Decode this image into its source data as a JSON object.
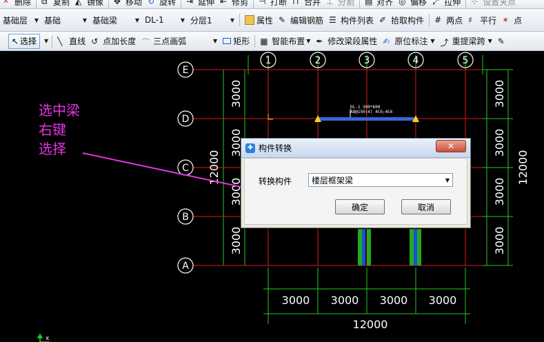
{
  "toolbar_top": {
    "items": [
      {
        "label": "删除",
        "icon": "delete-icon"
      },
      {
        "label": "复制",
        "icon": "copy-icon"
      },
      {
        "label": "镜像",
        "icon": "mirror-icon"
      },
      {
        "label": "移动",
        "icon": "move-icon"
      },
      {
        "label": "旋转",
        "icon": "rotate-icon"
      },
      {
        "label": "延伸",
        "icon": "extend-icon"
      },
      {
        "label": "修剪",
        "icon": "trim-icon"
      },
      {
        "label": "打断",
        "icon": "break-icon"
      },
      {
        "label": "合并",
        "icon": "merge-icon"
      },
      {
        "label": "分割",
        "icon": "split-icon"
      },
      {
        "label": "对齐",
        "icon": "align-icon"
      },
      {
        "label": "偏移",
        "icon": "offset-icon"
      },
      {
        "label": "拉伸",
        "icon": "stretch-icon"
      },
      {
        "label": "设置夹点",
        "icon": "grip-icon"
      }
    ]
  },
  "toolbar_mid": {
    "combos": [
      "基础层",
      "基础",
      "基础梁",
      "DL-1",
      "分层1"
    ],
    "buttons": [
      {
        "label": "属性",
        "icon": "properties-icon"
      },
      {
        "label": "编辑钢筋",
        "icon": "edit-rebar-icon"
      },
      {
        "label": "构件列表",
        "icon": "component-list-icon"
      },
      {
        "label": "拾取构件",
        "icon": "pick-component-icon"
      },
      {
        "label": "两点",
        "icon": "two-point-axis-icon"
      },
      {
        "label": "平行",
        "icon": "parallel-axis-icon"
      },
      {
        "label": "点",
        "icon": "point-angle-icon"
      }
    ]
  },
  "toolbar_draw": {
    "select_label": "选择",
    "items": [
      {
        "label": "直线",
        "icon": "line-icon"
      },
      {
        "label": "点加长度",
        "icon": "point-length-icon"
      },
      {
        "label": "三点画弧",
        "icon": "three-point-arc-icon"
      },
      {
        "label": "矩形",
        "icon": "rectangle-icon"
      },
      {
        "label": "智能布置",
        "icon": "smart-layout-icon"
      },
      {
        "label": "修改梁段属性",
        "icon": "modify-beam-icon"
      },
      {
        "label": "原位标注",
        "icon": "in-situ-label-icon"
      },
      {
        "label": "重提梁跨",
        "icon": "re-extract-span-icon"
      }
    ]
  },
  "drawing": {
    "axis_columns": [
      "1",
      "2",
      "3",
      "4",
      "5"
    ],
    "axis_rows": [
      "E",
      "D",
      "C",
      "B",
      "A"
    ],
    "left_dims": [
      "3000",
      "3000",
      "3000",
      "3000"
    ],
    "left_total": "12000",
    "right_dims": [
      "3000",
      "3000",
      "3000",
      "3000"
    ],
    "right_total": "12000",
    "bottom_dims": [
      "3000",
      "3000",
      "3000",
      "3000"
    ],
    "bottom_total": "12000",
    "beam_label_line1": "DL-1 300*600",
    "beam_label_line2": "A8@150(4) 4C6;4C6",
    "colors": {
      "axis_red": "#e01818",
      "dim_green": "#22cc22",
      "beam_blue": "#3a66d8",
      "annot_magenta": "#e234e2"
    }
  },
  "annotation": {
    "lines": [
      "选中梁",
      "右键",
      "选择"
    ]
  },
  "dialog": {
    "title": "构件转换",
    "field_label": "转换构件",
    "selected_value": "楼层框架梁",
    "ok_label": "确定",
    "cancel_label": "取消"
  }
}
